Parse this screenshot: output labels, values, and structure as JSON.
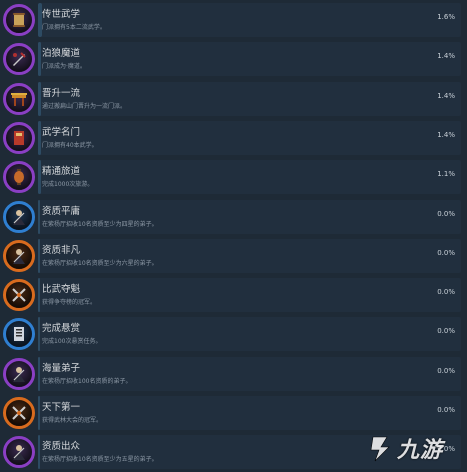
{
  "achievements": [
    {
      "name": "传世武学",
      "description": "门派拥有5本二流武学。",
      "percent": "1.6%",
      "percent_value": 1.6,
      "icon": "scroll-icon",
      "color": "purple"
    },
    {
      "name": "泊狼魔道",
      "description": "门派成为·魔道。",
      "percent": "1.4%",
      "percent_value": 1.4,
      "icon": "demon-sword-icon",
      "color": "purple"
    },
    {
      "name": "晋升一流",
      "description": "通过搬扁山门晋升为一流门派。",
      "percent": "1.4%",
      "percent_value": 1.4,
      "icon": "gate-icon",
      "color": "purple"
    },
    {
      "name": "武学名门",
      "description": "门派拥有40本武学。",
      "percent": "1.4%",
      "percent_value": 1.4,
      "icon": "book-icon",
      "color": "purple"
    },
    {
      "name": "精通旅道",
      "description": "完成1000次旅游。",
      "percent": "1.1%",
      "percent_value": 1.1,
      "icon": "lantern-icon",
      "color": "purple"
    },
    {
      "name": "资质平庸",
      "description": "在紫杨厅招收10名资质至少为四星的弟子。",
      "percent": "0.0%",
      "percent_value": 0.0,
      "icon": "disciple-icon",
      "color": "blue"
    },
    {
      "name": "资质非凡",
      "description": "在紫杨厅招收10名资质至少为六星的弟子。",
      "percent": "0.0%",
      "percent_value": 0.0,
      "icon": "disciple-icon",
      "color": "orange"
    },
    {
      "name": "比武夺魁",
      "description": "获得争夺榜的冠军。",
      "percent": "0.0%",
      "percent_value": 0.0,
      "icon": "crossed-swords-icon",
      "color": "orange"
    },
    {
      "name": "完成悬赏",
      "description": "完成100次悬赏任务。",
      "percent": "0.0%",
      "percent_value": 0.0,
      "icon": "bounty-scroll-icon",
      "color": "blue"
    },
    {
      "name": "海量弟子",
      "description": "在紫杨厅招收100名资质的弟子。",
      "percent": "0.0%",
      "percent_value": 0.0,
      "icon": "disciple-icon",
      "color": "purple"
    },
    {
      "name": "天下第一",
      "description": "获得武林大会的冠军。",
      "percent": "0.0%",
      "percent_value": 0.0,
      "icon": "crossed-swords-icon",
      "color": "orange"
    },
    {
      "name": "资质出众",
      "description": "在紫杨厅招收10名资质至少为五星的弟子。",
      "percent": "0.0%",
      "percent_value": 0.0,
      "icon": "disciple-icon",
      "color": "purple"
    }
  ],
  "watermark": {
    "text": "九游"
  },
  "colors": {
    "background": "#1b2838",
    "bar": "#212f3e",
    "fill": "#2d4b63",
    "purple": "#8a3fc4",
    "blue": "#2f7fd1",
    "orange": "#d86b1e"
  }
}
